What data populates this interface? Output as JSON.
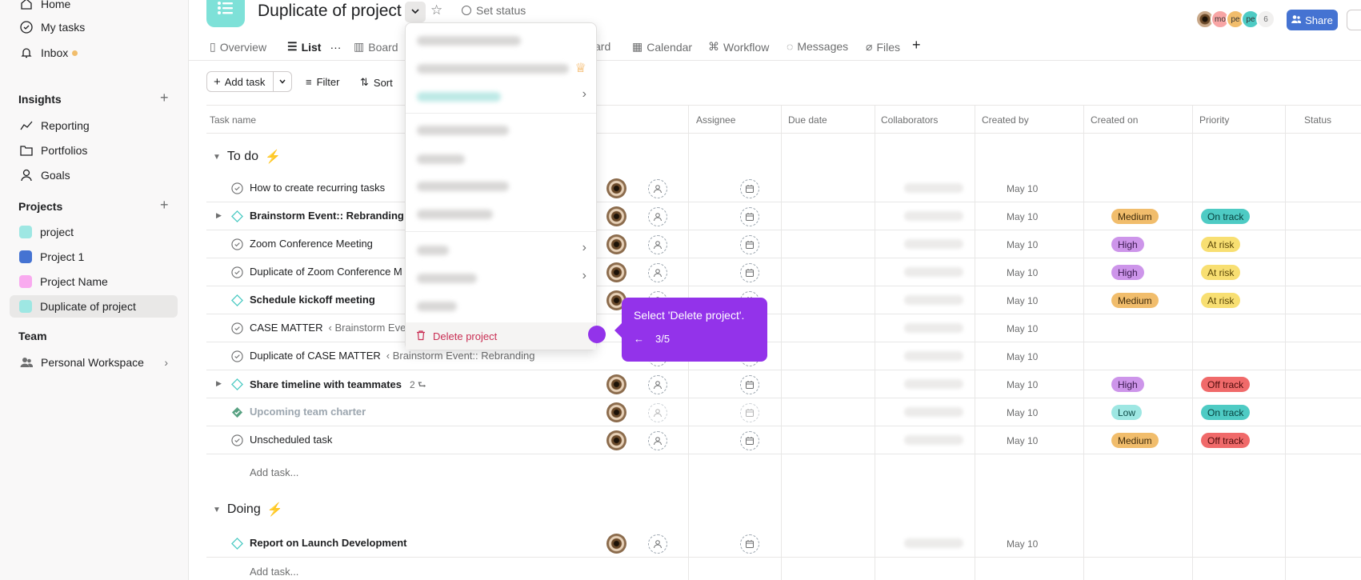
{
  "sidebar": {
    "nav": [
      {
        "label": "Home",
        "icon": "home-icon"
      },
      {
        "label": "My tasks",
        "icon": "check-circle-icon"
      },
      {
        "label": "Inbox",
        "icon": "bell-icon"
      }
    ],
    "insights": {
      "title": "Insights",
      "items": [
        {
          "label": "Reporting",
          "icon": "chart-line-icon"
        },
        {
          "label": "Portfolios",
          "icon": "folder-icon"
        },
        {
          "label": "Goals",
          "icon": "person-icon"
        }
      ]
    },
    "projects": {
      "title": "Projects",
      "items": [
        {
          "label": "project",
          "color": "#9ee7e3"
        },
        {
          "label": "Project 1",
          "color": "#4573d2"
        },
        {
          "label": "Project Name",
          "color": "#f9aaef"
        },
        {
          "label": "Duplicate of project",
          "color": "#9ee7e3"
        }
      ]
    },
    "team": {
      "title": "Team",
      "items": [
        {
          "label": "Personal Workspace"
        }
      ]
    }
  },
  "header": {
    "title": "Duplicate of project",
    "set_status": "Set status",
    "avatars": [
      "mo",
      "pe",
      "pe"
    ],
    "avatar_count": "6",
    "share": "Share"
  },
  "tabs": [
    {
      "label": "Overview"
    },
    {
      "label": "List"
    },
    {
      "label": "Board"
    },
    {
      "label": "ard"
    },
    {
      "label": "Calendar"
    },
    {
      "label": "Workflow"
    },
    {
      "label": "Messages"
    },
    {
      "label": "Files"
    }
  ],
  "toolbar": {
    "add_task": "Add task",
    "filter": "Filter",
    "sort": "Sort"
  },
  "columns": [
    "Task name",
    "Assignee",
    "Due date",
    "Collaborators",
    "Created by",
    "Created on",
    "Priority",
    "Status"
  ],
  "sections": [
    {
      "title": "To do",
      "tasks": [
        {
          "name": "How to create recurring tasks",
          "created_on": "May 10",
          "priority": "",
          "status": ""
        },
        {
          "name": "Brainstorm Event:: Rebranding",
          "created_on": "May 10",
          "priority": "Medium",
          "status": "On track"
        },
        {
          "name": "Zoom Conference Meeting",
          "created_on": "May 10",
          "priority": "High",
          "status": "At risk"
        },
        {
          "name": "Duplicate of Zoom Conference M",
          "created_on": "May 10",
          "priority": "High",
          "status": "At risk"
        },
        {
          "name": "Schedule kickoff meeting",
          "created_on": "May 10",
          "priority": "Medium",
          "status": "At risk"
        },
        {
          "name": "CASE MATTER",
          "crumb": "‹ Brainstorm Eve",
          "created_on": "May 10",
          "priority": "",
          "status": ""
        },
        {
          "name": "Duplicate of CASE MATTER",
          "crumb": "‹ Brainstorm Event:: Rebranding",
          "created_on": "May 10",
          "priority": "",
          "status": ""
        },
        {
          "name": "Share timeline with teammates",
          "subtasks": "2",
          "created_on": "May 10",
          "priority": "High",
          "status": "Off track"
        },
        {
          "name": "Upcoming team charter",
          "created_on": "May 10",
          "priority": "Low",
          "status": "On track"
        },
        {
          "name": "Unscheduled task",
          "created_on": "May 10",
          "priority": "Medium",
          "status": "Off track"
        }
      ],
      "add_task": "Add task..."
    },
    {
      "title": "Doing",
      "tasks": [
        {
          "name": "Report on Launch Development",
          "created_on": "May 10",
          "priority": "",
          "status": ""
        }
      ],
      "add_task": "Add task..."
    }
  ],
  "menu": {
    "delete": "Delete project"
  },
  "tooltip": {
    "text": "Select 'Delete project'.",
    "step": "3/5"
  }
}
